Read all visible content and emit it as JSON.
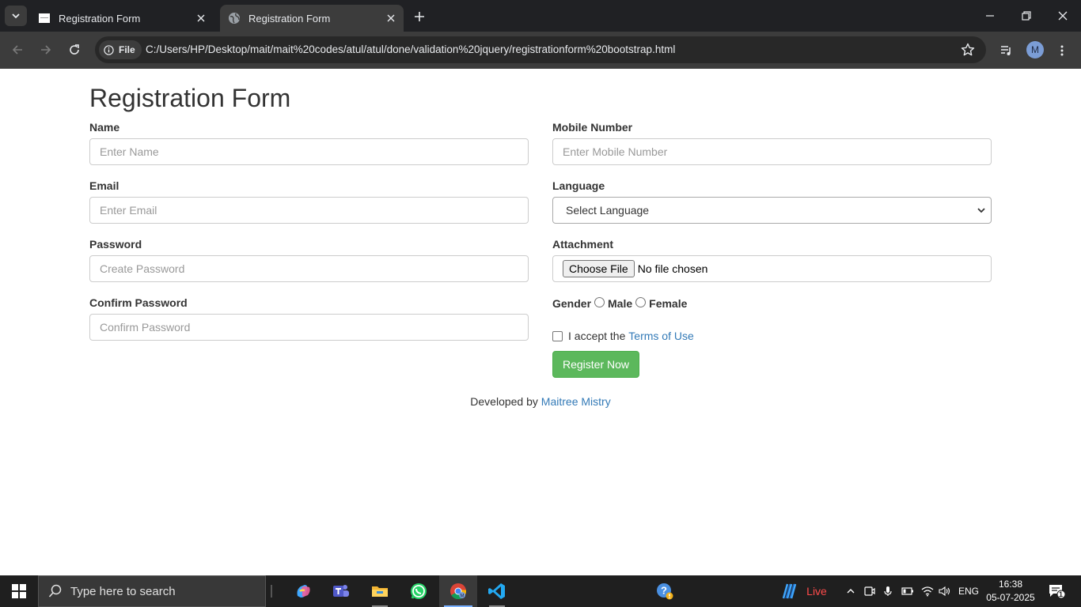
{
  "browser": {
    "tabs": [
      {
        "title": "Registration Form",
        "active": false
      },
      {
        "title": "Registration Form",
        "active": true
      }
    ],
    "address": {
      "scheme_chip": "File",
      "url": "C:/Users/HP/Desktop/mait/mait%20codes/atul/atul/done/validation%20jquery/registrationform%20bootstrap.html"
    },
    "profile_initial": "M"
  },
  "form": {
    "heading": "Registration Form",
    "name": {
      "label": "Name",
      "placeholder": "Enter Name"
    },
    "email": {
      "label": "Email",
      "placeholder": "Enter Email"
    },
    "password": {
      "label": "Password",
      "placeholder": "Create Password"
    },
    "confirm_password": {
      "label": "Confirm Password",
      "placeholder": "Confirm Password"
    },
    "mobile": {
      "label": "Mobile Number",
      "placeholder": "Enter Mobile Number"
    },
    "language": {
      "label": "Language",
      "selected": "Select Language"
    },
    "attachment": {
      "label": "Attachment",
      "button": "Choose File",
      "status": "No file chosen"
    },
    "gender": {
      "label": "Gender",
      "options": [
        "Male",
        "Female"
      ]
    },
    "terms": {
      "prefix": "I accept the ",
      "link": "Terms of Use"
    },
    "submit": "Register Now"
  },
  "footer": {
    "prefix": "Developed by ",
    "author": "Maitree Mistry"
  },
  "taskbar": {
    "search_placeholder": "Type here to search",
    "apps": [
      "copilot-icon",
      "teams-icon",
      "file-explorer-icon",
      "whatsapp-icon",
      "chrome-icon",
      "vscode-icon",
      "help-icon"
    ],
    "live_label": "Live",
    "language": "ENG",
    "time": "16:38",
    "date": "05-07-2025",
    "notification_count": "1"
  },
  "colors": {
    "accent_link": "#337ab7",
    "button_green": "#5cb85c",
    "chrome_dark": "#202124",
    "live_red": "#ff4b4b"
  }
}
